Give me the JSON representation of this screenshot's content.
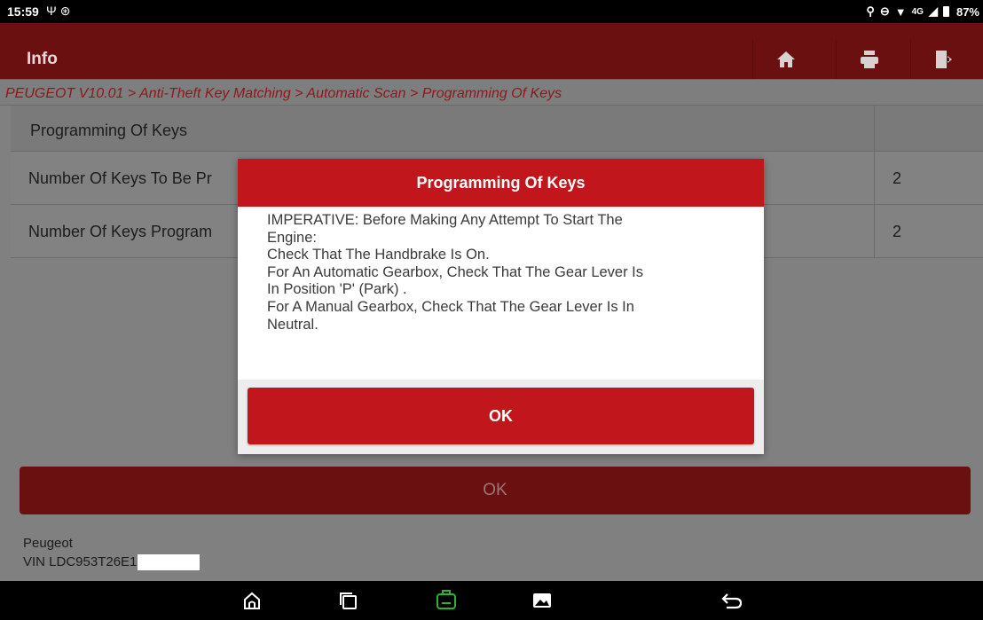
{
  "status_bar": {
    "time": "15:59",
    "left_icons": [
      "usb-icon",
      "bluetooth-icon"
    ],
    "right_icons": [
      "location-icon",
      "dnd-icon",
      "wifi-icon",
      "signal-icon",
      "battery-icon"
    ],
    "network": "4G",
    "battery": "87%"
  },
  "header": {
    "title": "Info",
    "buttons": [
      "home-icon",
      "print-icon",
      "exit-icon"
    ]
  },
  "breadcrumb": "PEUGEOT V10.01 > Anti-Theft Key Matching > Automatic Scan > Programming Of Keys",
  "table": {
    "header": "Programming Of Keys",
    "rows": [
      {
        "label": "Number Of Keys To Be Pr",
        "value": "2"
      },
      {
        "label": "Number Of Keys Program",
        "value": "2"
      }
    ]
  },
  "bottom_button": "OK",
  "vehicle": {
    "make": "Peugeot",
    "vin": "VIN LDC953T26E1"
  },
  "dialog": {
    "title": "Programming Of Keys",
    "lines": [
      "IMPERATIVE: Before Making Any Attempt To Start The",
      "Engine:",
      "Check That The Handbrake Is On.",
      "For An Automatic Gearbox, Check That The Gear Lever Is",
      "In Position 'P' (Park) .",
      "For A Manual Gearbox, Check That The Gear Lever Is In",
      "Neutral."
    ],
    "ok_label": "OK"
  },
  "colors": {
    "accent": "#c0161c",
    "dimmed_accent": "#6a1010",
    "vci_green": "#2bb52b"
  },
  "nav_bar": [
    "home-icon",
    "recent-apps-icon",
    "vci-icon",
    "gallery-icon",
    "back-icon"
  ]
}
